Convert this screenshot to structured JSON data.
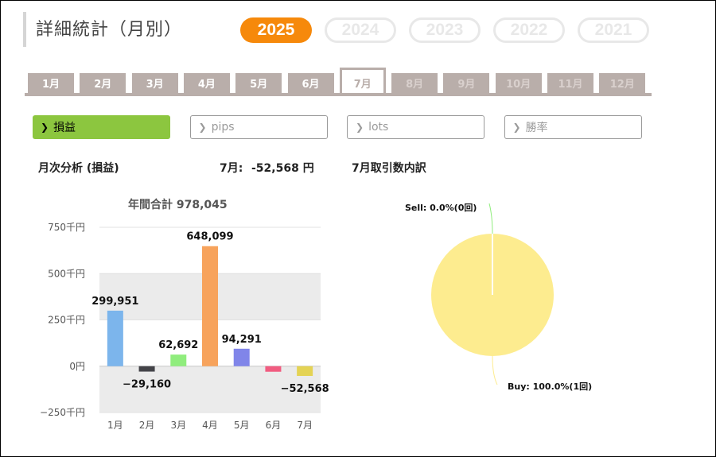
{
  "header": {
    "title": "詳細統計（月別）"
  },
  "years": [
    {
      "label": "2025",
      "active": true
    },
    {
      "label": "2024",
      "active": false
    },
    {
      "label": "2023",
      "active": false
    },
    {
      "label": "2022",
      "active": false
    },
    {
      "label": "2021",
      "active": false
    }
  ],
  "months": [
    {
      "label": "1月",
      "state": "past"
    },
    {
      "label": "2月",
      "state": "past"
    },
    {
      "label": "3月",
      "state": "past"
    },
    {
      "label": "4月",
      "state": "past"
    },
    {
      "label": "5月",
      "state": "past"
    },
    {
      "label": "6月",
      "state": "past"
    },
    {
      "label": "7月",
      "state": "active"
    },
    {
      "label": "8月",
      "state": "future"
    },
    {
      "label": "9月",
      "state": "future"
    },
    {
      "label": "10月",
      "state": "future"
    },
    {
      "label": "11月",
      "state": "future"
    },
    {
      "label": "12月",
      "state": "future"
    }
  ],
  "metrics": [
    {
      "label": "損益",
      "active": true
    },
    {
      "label": "pips",
      "active": false
    },
    {
      "label": "lots",
      "active": false
    },
    {
      "label": "勝率",
      "active": false
    }
  ],
  "summary": {
    "monthly_analysis_label": "月次分析 (損益)",
    "current_month_label": "7月:",
    "current_month_value": "-52,568 円",
    "breakdown_label": "7月取引数内訳"
  },
  "colors": {
    "year_active": "#f6890b",
    "metric_active": "#8cc63f",
    "tab": "#b9aeaa"
  },
  "chart_data": [
    {
      "type": "bar",
      "title": "年間合計 978,045",
      "categories": [
        "1月",
        "2月",
        "3月",
        "4月",
        "5月",
        "6月",
        "7月"
      ],
      "values": [
        299951,
        -29160,
        62692,
        648099,
        94291,
        -30000,
        -52568
      ],
      "data_labels": [
        "299,951",
        "−29,160",
        "62,692",
        "648,099",
        "94,291",
        "",
        "−52,568"
      ],
      "colors": [
        "#7cb5ec",
        "#434348",
        "#90ed7d",
        "#f7a35c",
        "#8085e9",
        "#f15c80",
        "#e4d354"
      ],
      "yticks": [
        {
          "value": 750000,
          "label": "750千円"
        },
        {
          "value": 500000,
          "label": "500千円"
        },
        {
          "value": 250000,
          "label": "250千円"
        },
        {
          "value": 0,
          "label": "0円"
        },
        {
          "value": -250000,
          "label": "−250千円"
        }
      ],
      "ylim": [
        -250000,
        750000
      ],
      "grid": "alternating bands",
      "legend": "none"
    },
    {
      "type": "pie",
      "slices": [
        {
          "name": "Sell",
          "value": 0,
          "label": "Sell: 0.0%(0回)",
          "color": "#90ed7d"
        },
        {
          "name": "Buy",
          "value": 100,
          "label": "Buy: 100.0%(1回)",
          "color": "#fdec8f"
        }
      ]
    }
  ]
}
